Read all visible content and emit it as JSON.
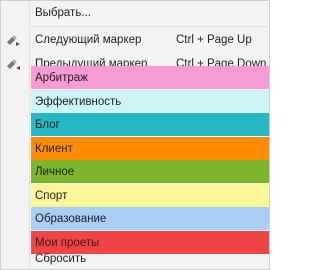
{
  "menu": {
    "select": {
      "label": "Выбрать..."
    },
    "next": {
      "label": "Следующий маркер",
      "shortcut": "Ctrl + Page Up",
      "icon": "marker-next-icon"
    },
    "prev": {
      "label": "Предыдущий маркер",
      "shortcut": "Ctrl + Page Down",
      "icon": "marker-prev-icon"
    },
    "colors": [
      {
        "label": "Арбитраж",
        "color": "#f79bd3",
        "text_color": "#1f1f1f"
      },
      {
        "label": "Эффективность",
        "color": "#cdf4f7",
        "text_color": "#1f1f1f"
      },
      {
        "label": "Блог",
        "color": "#26b8c5",
        "text_color": "#1f1f1f"
      },
      {
        "label": "Клиент",
        "color": "#ff8c00",
        "text_color": "#1f1f1f"
      },
      {
        "label": "Личное",
        "color": "#7db62a",
        "text_color": "#1f1f1f"
      },
      {
        "label": "Спорт",
        "color": "#f9f79a",
        "text_color": "#1f1f1f"
      },
      {
        "label": "Образование",
        "color": "#a9cff6",
        "text_color": "#1f1f1f"
      },
      {
        "label": "Мои проеты",
        "color": "#ef4545",
        "text_color": "#3a1a1a"
      }
    ],
    "reset": {
      "label": "Сбросить"
    }
  }
}
